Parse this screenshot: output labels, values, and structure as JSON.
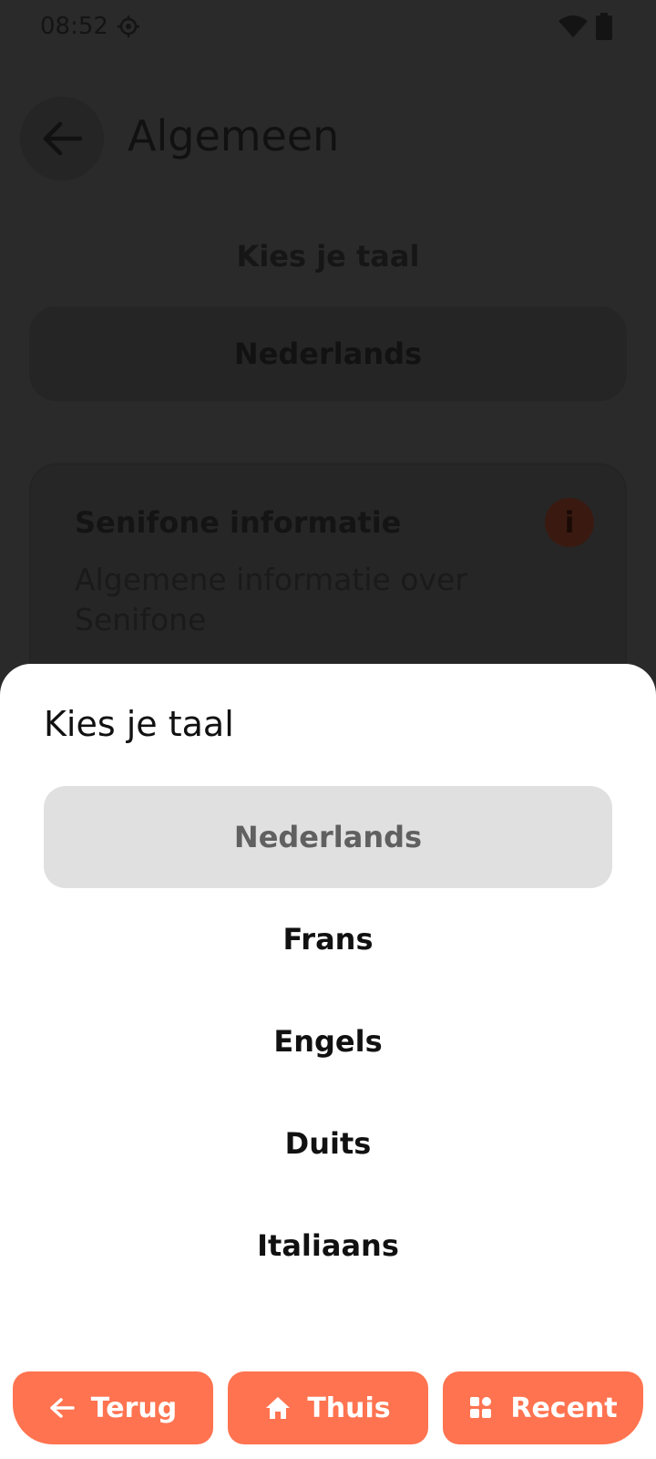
{
  "status": {
    "time": "08:52"
  },
  "header": {
    "title": "Algemeen"
  },
  "settings": {
    "language_label": "Kies je taal",
    "current_language": "Nederlands",
    "info_card": {
      "title": "Senifone informatie",
      "subtitle": "Algemene informatie over Senifone",
      "icon_glyph": "i"
    }
  },
  "sheet": {
    "title": "Kies je taal",
    "options": [
      {
        "label": "Nederlands",
        "selected": true
      },
      {
        "label": "Frans",
        "selected": false
      },
      {
        "label": "Engels",
        "selected": false
      },
      {
        "label": "Duits",
        "selected": false
      },
      {
        "label": "Italiaans",
        "selected": false
      }
    ]
  },
  "nav": {
    "back_label": "Terug",
    "home_label": "Thuis",
    "recent_label": "Recent"
  },
  "colors": {
    "accent": "#ff7350",
    "selected_bg": "#e0e0e0",
    "overlay": "#2a2a2a"
  },
  "icons": [
    "location-icon",
    "wifi-icon",
    "battery-icon",
    "back-arrow-icon",
    "info-icon",
    "home-icon",
    "apps-icon"
  ]
}
